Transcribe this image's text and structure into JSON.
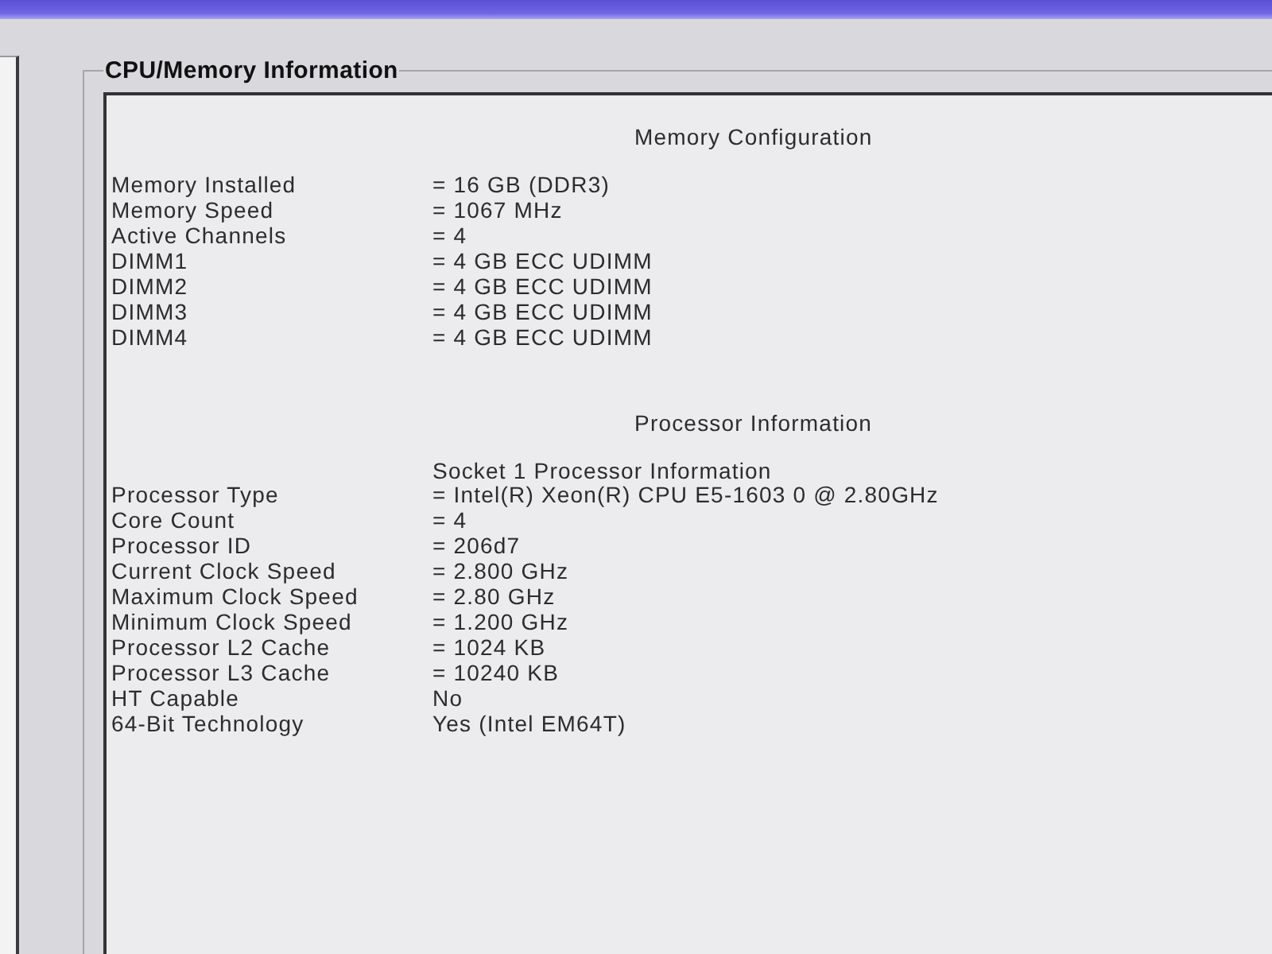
{
  "group": {
    "title": "CPU/Memory Information"
  },
  "sections": [
    {
      "heading": "Memory Configuration",
      "rows": [
        {
          "label": "Memory Installed",
          "value": "= 16 GB (DDR3)"
        },
        {
          "label": "Memory Speed",
          "value": "= 1067 MHz"
        },
        {
          "label": "Active Channels",
          "value": "= 4"
        },
        {
          "label": "DIMM1",
          "value": "= 4 GB ECC UDIMM"
        },
        {
          "label": "DIMM2",
          "value": "= 4 GB ECC UDIMM"
        },
        {
          "label": "DIMM3",
          "value": "= 4 GB ECC UDIMM"
        },
        {
          "label": "DIMM4",
          "value": "= 4 GB ECC UDIMM"
        }
      ]
    },
    {
      "heading": "Processor Information",
      "subheading": "Socket 1 Processor Information",
      "rows": [
        {
          "label": "Processor Type",
          "value": "= Intel(R) Xeon(R) CPU E5-1603 0 @ 2.80GHz"
        },
        {
          "label": "Core Count",
          "value": "= 4"
        },
        {
          "label": "Processor ID",
          "value": "= 206d7"
        },
        {
          "label": "Current Clock Speed",
          "value": "= 2.800 GHz"
        },
        {
          "label": "Maximum Clock Speed",
          "value": "= 2.80 GHz"
        },
        {
          "label": "Minimum Clock Speed",
          "value": "= 1.200 GHz"
        },
        {
          "label": "Processor L2 Cache",
          "value": "= 1024 KB"
        },
        {
          "label": "Processor L3 Cache",
          "value": "= 10240 KB"
        },
        {
          "label": "HT Capable",
          "value": "No"
        },
        {
          "label": "64-Bit Technology",
          "value": "Yes (Intel EM64T)"
        }
      ]
    }
  ]
}
